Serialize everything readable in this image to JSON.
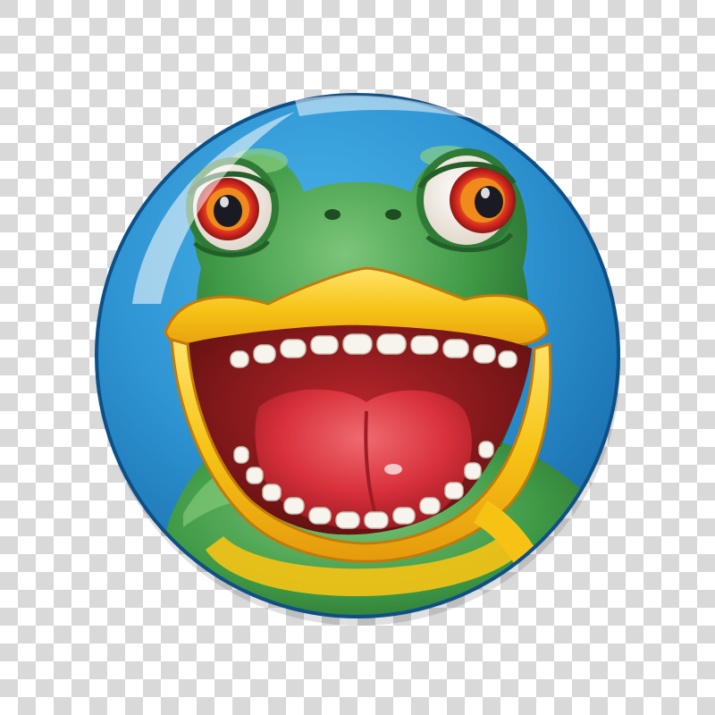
{
  "image": {
    "subject": "frog-badge",
    "background_pattern": "transparency-checkerboard"
  },
  "colors": {
    "checker_light": "#ffffff",
    "checker_dark": "#d9d9d9",
    "badge_blue": "#2f95d3",
    "badge_blue_dark": "#1a6fae",
    "badge_rim": "#0d4f86",
    "frog_green": "#3f9a46",
    "frog_green_dark": "#245f2a",
    "frog_green_light": "#7cc57a",
    "beak_yellow": "#f6c315",
    "beak_orange": "#e69a0d",
    "mouth_dark": "#7a1a1a",
    "tongue_red": "#d8303a",
    "tongue_light": "#f06a70",
    "teeth": "#f7f4ee",
    "eye_white": "#f2ede6",
    "iris_orange": "#f08a1c",
    "iris_red": "#d4271f",
    "iris_yellow": "#f7d23a",
    "pupil": "#1a1a22"
  }
}
